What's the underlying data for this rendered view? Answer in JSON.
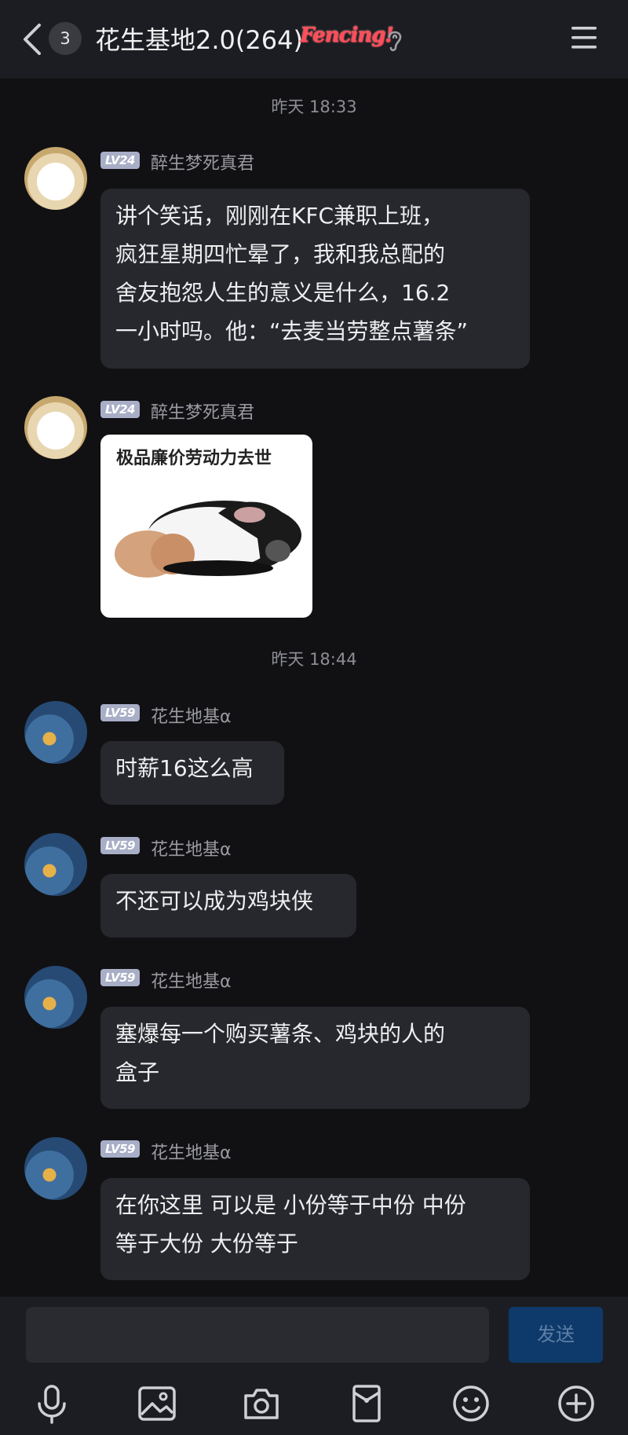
{
  "header": {
    "unread_count": "3",
    "title": "花生基地2.0(264)",
    "title_tag": "Fencing!"
  },
  "timestamps": [
    "昨天 18:33",
    "昨天 18:44"
  ],
  "messages": [
    {
      "level": "LV24",
      "sender": "醉生梦死真君",
      "lines": [
        "讲个笑话，刚刚在KFC兼职上班，",
        "疯狂星期四忙晕了，我和我总配的",
        "舍友抱怨人生的意义是什么，16.2",
        "一小时吗。他：“去麦当劳整点薯条”"
      ]
    },
    {
      "level": "LV24",
      "sender": "醉生梦死真君",
      "sticker_caption": "极品廉价劳动力去世"
    },
    {
      "level": "LV59",
      "sender": "花生地基α",
      "lines": [
        "时薪16这么高"
      ]
    },
    {
      "level": "LV59",
      "sender": "花生地基α",
      "lines": [
        "不还可以成为鸡块侠"
      ]
    },
    {
      "level": "LV59",
      "sender": "花生地基α",
      "lines": [
        "塞爆每一个购买薯条、鸡块的人的",
        "盒子"
      ]
    },
    {
      "level": "LV59",
      "sender": "花生地基α",
      "lines": [
        "在你这里 可以是 小份等于中份 中份",
        "等于大份 大份等于"
      ]
    }
  ],
  "composer": {
    "input_value": "",
    "send_label": "发送"
  },
  "toolbar_icons": [
    "microphone-icon",
    "image-icon",
    "camera-icon",
    "red-packet-icon",
    "emoji-icon",
    "plus-icon"
  ],
  "colors": {
    "background": "#111114",
    "bar": "#1c1d22",
    "bubble": "#27282d",
    "send_button": "#0e3a6b",
    "title_tag": "#ff4d5a"
  }
}
